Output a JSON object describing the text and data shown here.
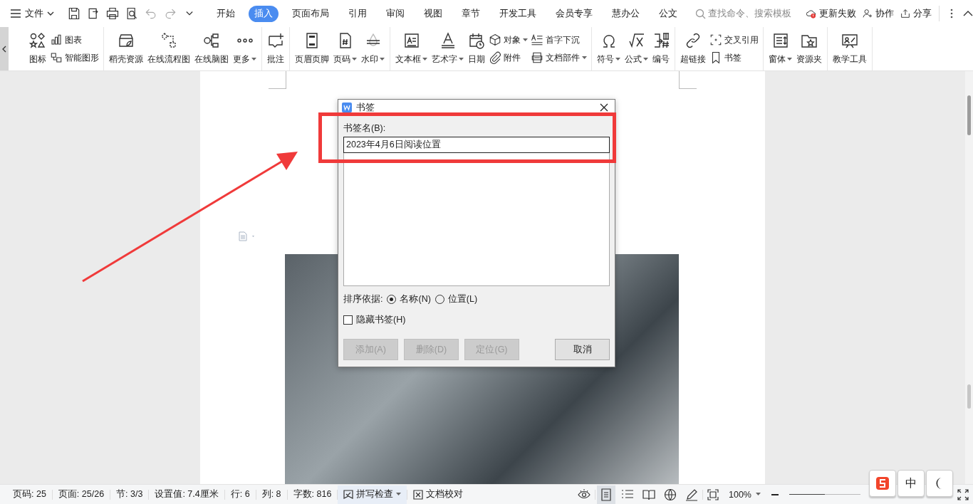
{
  "title_bar": {
    "file_menu": "文件",
    "tabs": [
      {
        "label": "开始",
        "selected": false
      },
      {
        "label": "插入",
        "selected": true
      },
      {
        "label": "页面布局",
        "selected": false
      },
      {
        "label": "引用",
        "selected": false
      },
      {
        "label": "审阅",
        "selected": false
      },
      {
        "label": "视图",
        "selected": false
      },
      {
        "label": "章节",
        "selected": false
      },
      {
        "label": "开发工具",
        "selected": false
      },
      {
        "label": "会员专享",
        "selected": false
      },
      {
        "label": "慧办公",
        "selected": false
      },
      {
        "label": "公文",
        "selected": false
      }
    ],
    "search": {
      "placeholder": "查找命令、搜索模板"
    },
    "actions": [
      "更新失败",
      "协作",
      "分享"
    ]
  },
  "ribbon": {
    "groups": [
      {
        "items": [
          {
            "kind": "large",
            "label": "图标",
            "caret": false
          },
          {
            "kind": "stack",
            "items": [
              {
                "label": "图表",
                "caret": false
              },
              {
                "label": "智能图形",
                "caret": false
              }
            ]
          }
        ]
      },
      {
        "items": [
          {
            "kind": "large",
            "label": "稻壳资源",
            "caret": false
          },
          {
            "kind": "large",
            "label": "在线流程图",
            "caret": false
          },
          {
            "kind": "large",
            "label": "在线脑图",
            "caret": false
          },
          {
            "kind": "large",
            "label": "更多",
            "caret": true
          }
        ]
      },
      {
        "items": [
          {
            "kind": "large",
            "label": "批注",
            "caret": false
          }
        ]
      },
      {
        "items": [
          {
            "kind": "large",
            "label": "页眉页脚",
            "caret": false
          },
          {
            "kind": "large",
            "label": "页码",
            "caret": true
          },
          {
            "kind": "large",
            "label": "水印",
            "caret": true
          }
        ]
      },
      {
        "items": [
          {
            "kind": "large",
            "label": "文本框",
            "caret": true
          },
          {
            "kind": "large",
            "label": "艺术字",
            "caret": true
          },
          {
            "kind": "large",
            "label": "日期",
            "caret": false
          },
          {
            "kind": "stack",
            "items": [
              {
                "label": "对象",
                "caret": true
              },
              {
                "label": "附件",
                "caret": false
              }
            ]
          },
          {
            "kind": "stack",
            "items": [
              {
                "label": "首字下沉",
                "caret": false
              },
              {
                "label": "文档部件",
                "caret": true
              }
            ]
          }
        ]
      },
      {
        "items": [
          {
            "kind": "large",
            "label": "符号",
            "caret": true
          },
          {
            "kind": "large",
            "label": "公式",
            "caret": true
          },
          {
            "kind": "large",
            "label": "编号",
            "caret": false
          }
        ]
      },
      {
        "items": [
          {
            "kind": "large",
            "label": "超链接",
            "caret": false
          },
          {
            "kind": "stack",
            "items": [
              {
                "label": "交叉引用",
                "caret": false
              },
              {
                "label": "书签",
                "caret": false
              }
            ]
          }
        ]
      },
      {
        "items": [
          {
            "kind": "large",
            "label": "窗体",
            "caret": true
          },
          {
            "kind": "large",
            "label": "资源夹",
            "caret": false
          }
        ]
      },
      {
        "items": [
          {
            "kind": "large",
            "label": "教学工具",
            "caret": false
          }
        ]
      }
    ]
  },
  "dialog": {
    "title": "书签",
    "name_label": "书签名(B):",
    "name_value": "2023年4月6日阅读位置",
    "sort_label": "排序依据:",
    "sort_options": [
      {
        "label": "名称(N)",
        "selected": true
      },
      {
        "label": "位置(L)",
        "selected": false
      }
    ],
    "hidden_checkbox": {
      "label": "隐藏书签(H)",
      "checked": false
    },
    "buttons": [
      {
        "label": "添加(A)",
        "disabled": true
      },
      {
        "label": "删除(D)",
        "disabled": true
      },
      {
        "label": "定位(G)",
        "disabled": true
      },
      {
        "label": "取消",
        "disabled": false
      }
    ]
  },
  "ime_toolbar": {
    "mode": "中"
  },
  "status_bar": {
    "items": [
      "页码: 25",
      "页面: 25/26",
      "节: 3/3",
      "设置值: 7.4厘米",
      "行: 6",
      "列: 8",
      "字数: 816"
    ],
    "spell_check": "拼写检查",
    "proofread": "文档校对",
    "views": [
      {
        "kind": "eye",
        "selected": false
      },
      {
        "kind": "page",
        "selected": true
      },
      {
        "kind": "outline",
        "selected": false
      },
      {
        "kind": "book",
        "selected": false
      },
      {
        "kind": "web",
        "selected": false
      },
      {
        "kind": "pen",
        "selected": false
      }
    ],
    "zoom": "100%",
    "zoom_slider": {
      "level": 0.5
    }
  }
}
